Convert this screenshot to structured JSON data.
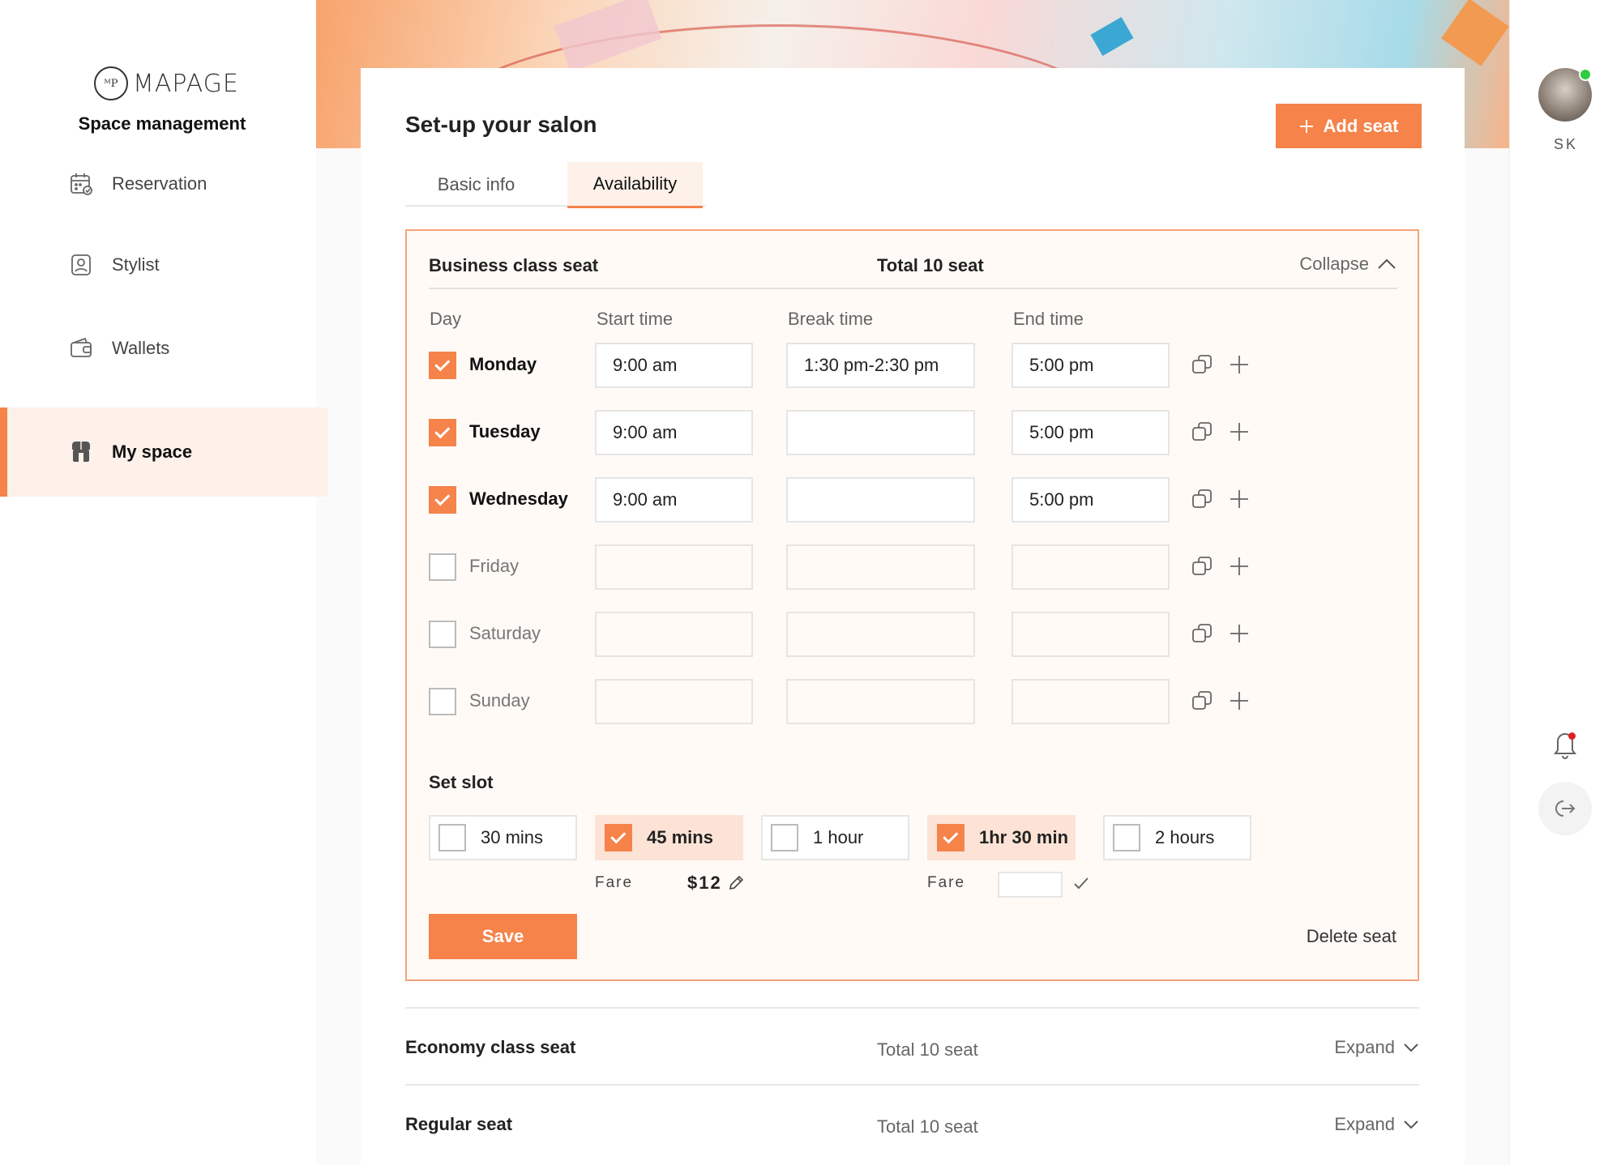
{
  "brand": {
    "logo_mark": "ᴹP",
    "name": "MAPAGE",
    "subtitle": "Space management"
  },
  "sidebar": {
    "items": [
      {
        "label": "Reservation",
        "icon": "calendar-icon"
      },
      {
        "label": "Stylist",
        "icon": "id-badge-icon"
      },
      {
        "label": "Wallets",
        "icon": "wallet-icon"
      },
      {
        "label": "My space",
        "icon": "shop-icon",
        "active": true
      }
    ]
  },
  "user": {
    "initials": "SK",
    "online": true
  },
  "page": {
    "title": "Set-up your salon",
    "add_seat_label": "Add seat",
    "tabs": [
      "Basic info",
      "Availability"
    ],
    "active_tab": "Availability"
  },
  "seat": {
    "name": "Business class seat",
    "total": "Total 10 seat",
    "collapse_label": "Collapse",
    "columns": [
      "Day",
      "Start time",
      "Break time",
      "End time"
    ],
    "days": [
      {
        "day": "Monday",
        "checked": true,
        "start": "9:00 am",
        "break": "1:30 pm-2:30 pm",
        "end": "5:00 pm"
      },
      {
        "day": "Tuesday",
        "checked": true,
        "start": "9:00 am",
        "break": "",
        "end": "5:00 pm"
      },
      {
        "day": "Wednesday",
        "checked": true,
        "start": "9:00 am",
        "break": "",
        "end": "5:00 pm"
      },
      {
        "day": "Friday",
        "checked": false,
        "start": "",
        "break": "",
        "end": ""
      },
      {
        "day": "Saturday",
        "checked": false,
        "start": "",
        "break": "",
        "end": ""
      },
      {
        "day": "Sunday",
        "checked": false,
        "start": "",
        "break": "",
        "end": ""
      }
    ],
    "slot_title": "Set slot",
    "slots": [
      {
        "label": "30 mins",
        "checked": false
      },
      {
        "label": "45 mins",
        "checked": true
      },
      {
        "label": "1 hour",
        "checked": false
      },
      {
        "label": "1hr 30 min",
        "checked": true
      },
      {
        "label": "2 hours",
        "checked": false
      }
    ],
    "fare_label": "Fare",
    "fare_value": "$12",
    "save_label": "Save",
    "delete_label": "Delete seat"
  },
  "other_seats": [
    {
      "name": "Economy class seat",
      "total": "Total 10 seat",
      "expand_label": "Expand"
    },
    {
      "name": "Regular seat",
      "total": "Total 10 seat",
      "expand_label": "Expand"
    }
  ],
  "colors": {
    "accent": "#f5834a",
    "accent_soft": "#fdf1ea",
    "panel_border": "#f5a27a",
    "online": "#2ecc40",
    "notification": "#e02020"
  }
}
